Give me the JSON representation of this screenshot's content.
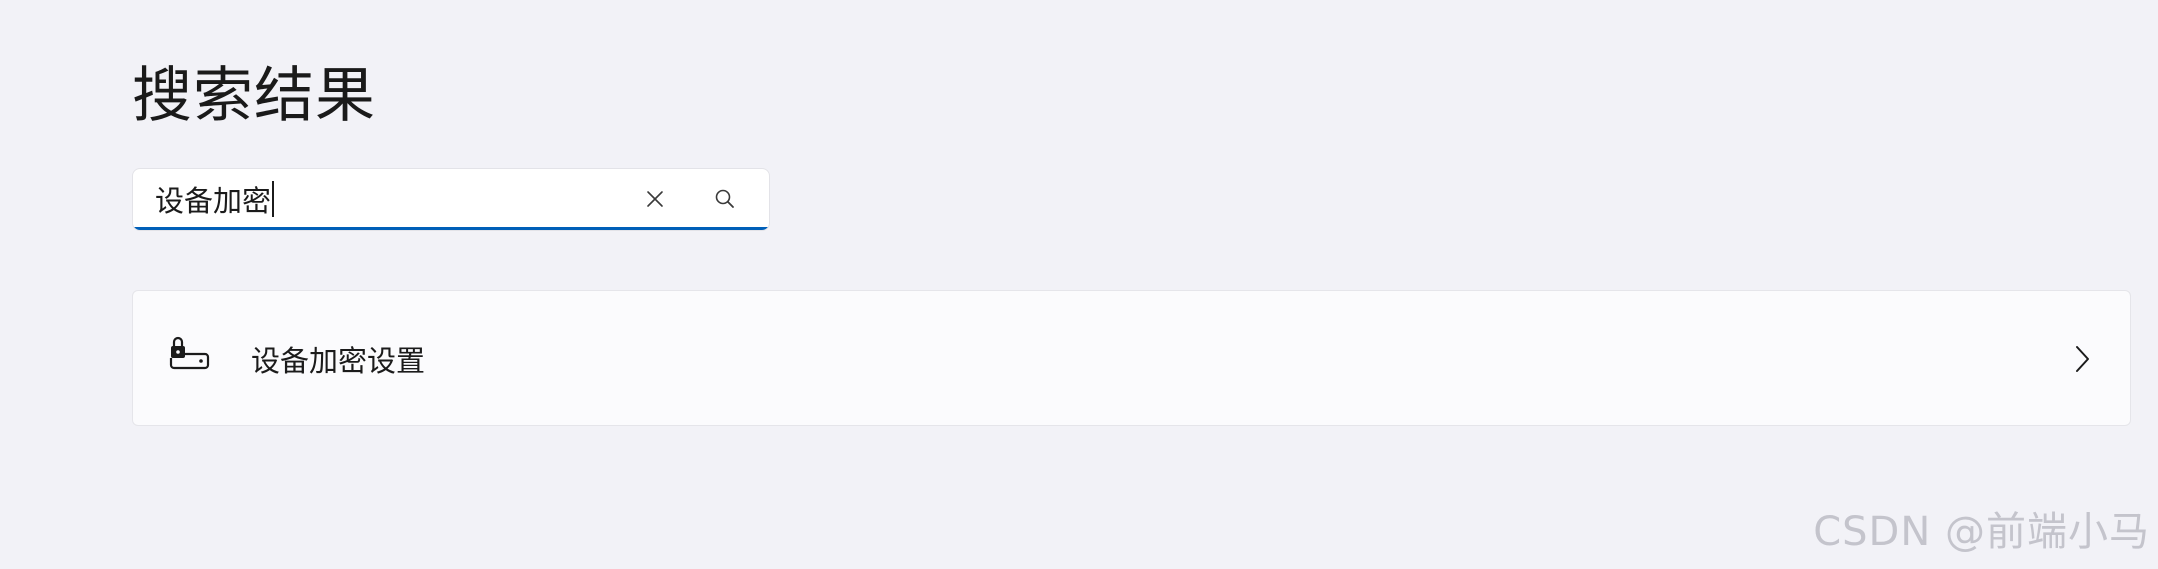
{
  "page": {
    "title": "搜索结果"
  },
  "search": {
    "value": "设备加密",
    "clear_icon": "close-icon",
    "search_icon": "search-icon",
    "accent_color": "#005fb8"
  },
  "results": [
    {
      "icon": "drive-lock-icon",
      "label": "设备加密设置",
      "chevron_icon": "chevron-right-icon"
    }
  ],
  "watermark": {
    "text": "CSDN @前端小马"
  }
}
